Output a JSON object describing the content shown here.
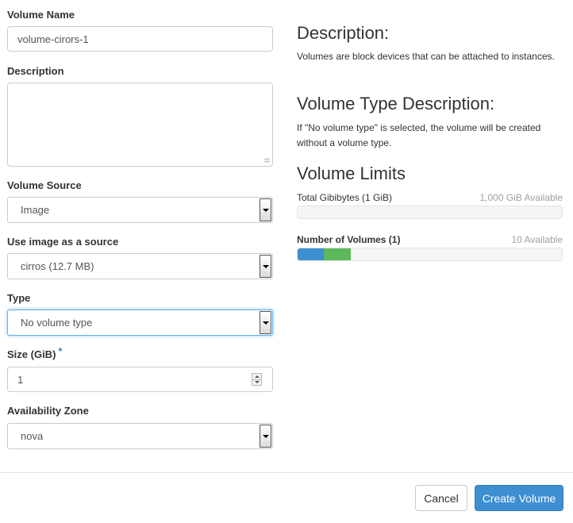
{
  "form": {
    "volume_name": {
      "label": "Volume Name",
      "value": "volume-cirors-1"
    },
    "description": {
      "label": "Description",
      "value": ""
    },
    "volume_source": {
      "label": "Volume Source",
      "value": "Image"
    },
    "image_source": {
      "label": "Use image as a source",
      "value": "cirros (12.7 MB)"
    },
    "type": {
      "label": "Type",
      "value": "No volume type"
    },
    "size": {
      "label": "Size (GiB)",
      "required_mark": "*",
      "value": "1"
    },
    "availability_zone": {
      "label": "Availability Zone",
      "value": "nova"
    }
  },
  "info": {
    "description_heading": "Description:",
    "description_text": "Volumes are block devices that can be attached to instances.",
    "type_heading": "Volume Type Description:",
    "type_text": "If \"No volume type\" is selected, the volume will be created without a volume type.",
    "limits_heading": "Volume Limits",
    "quotas": [
      {
        "label": "Total Gibibytes (1 GiB)",
        "available": "1,000 GiB Available",
        "used_fraction": 0.0,
        "added_fraction": 0.0
      },
      {
        "label": "Number of Volumes (1)",
        "available": "10 Available",
        "used_fraction": 0.1,
        "added_fraction": 0.1
      }
    ]
  },
  "colors": {
    "used": "#3d8fd1",
    "added": "#5cb85c",
    "primary": "#3d8fd1",
    "required": "#3f86c7"
  },
  "footer": {
    "cancel_label": "Cancel",
    "create_label": "Create Volume"
  }
}
